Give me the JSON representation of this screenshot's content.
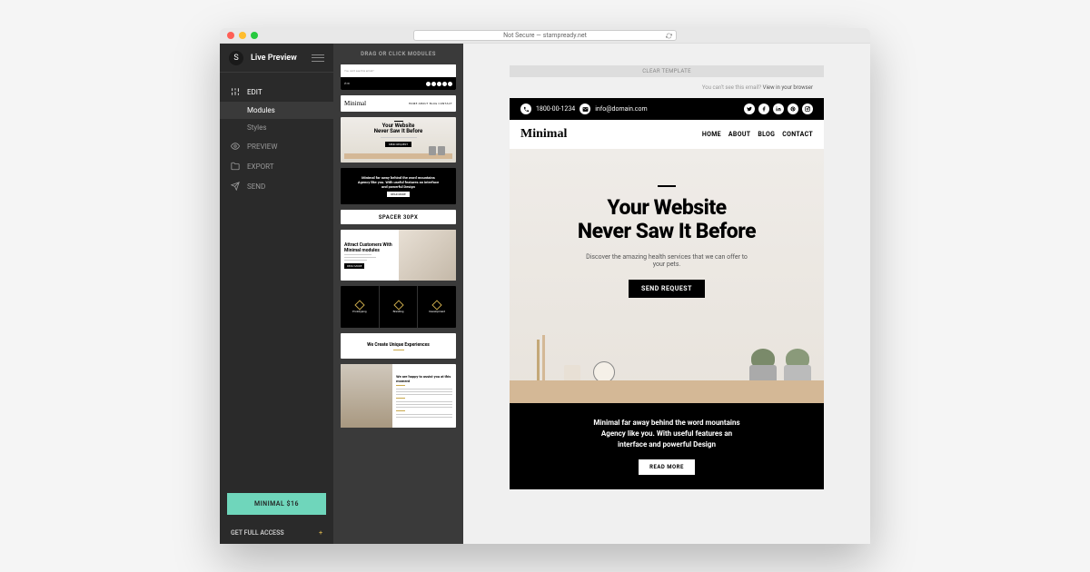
{
  "browser": {
    "url_prefix": "Not Secure —",
    "url": "stampready.net"
  },
  "sidebar": {
    "logo_letter": "S",
    "title": "Live Preview",
    "nav": [
      {
        "label": "EDIT",
        "icon": "sliders"
      },
      {
        "label": "PREVIEW",
        "icon": "eye"
      },
      {
        "label": "EXPORT",
        "icon": "folder"
      },
      {
        "label": "SEND",
        "icon": "plane"
      }
    ],
    "subnav": [
      {
        "label": "Modules",
        "active": true
      },
      {
        "label": "Styles",
        "active": false
      }
    ],
    "buy_label": "MINIMAL $16",
    "access_label": "GET FULL ACCESS"
  },
  "modules": {
    "heading": "DRAG OR CLICK MODULES",
    "spacer_label": "SPACER 30PX",
    "hero_line1": "Your Website",
    "hero_line2": "Never Saw It Before",
    "attract_title": "Attract Customers With Minimal modules",
    "unique_title": "We Create Unique Experiences",
    "dark_row_items": [
      "Prototyping",
      "Branding",
      "Development"
    ],
    "happy_title": "We are happy to assist you at this moment"
  },
  "preview": {
    "clear_label": "CLEAR TEMPLATE",
    "cant_see": "You can't see this email?",
    "view_browser": "View in your browser",
    "phone": "1800-00-1234",
    "email_addr": "info@domain.com",
    "brand": "Minimal",
    "nav": [
      "HOME",
      "ABOUT",
      "BLOG",
      "CONTACT"
    ],
    "hero_line1": "Your Website",
    "hero_line2": "Never Saw It Before",
    "hero_sub": "Discover the amazing health services that we can offer to your pets.",
    "cta": "SEND REQUEST",
    "black_line1": "Minimal far away behind the word mountains",
    "black_line2": "Agency like you. With useful features an",
    "black_line3": "interface and powerful Design",
    "read_more": "READ MORE",
    "social_icons": [
      "twitter",
      "facebook",
      "linkedin",
      "pinterest",
      "instagram"
    ]
  }
}
